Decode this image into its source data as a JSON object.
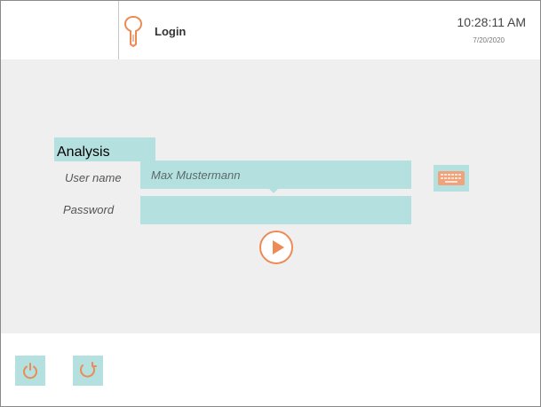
{
  "header": {
    "title": "Login",
    "time": "10:28:11 AM",
    "date": "7/20/2020"
  },
  "overlay_label": "Analysis",
  "login_form": {
    "username_label": "User name",
    "username_value": "Max Mustermann",
    "password_label": "Password",
    "password_value": ""
  },
  "icons": {
    "title": "key-icon",
    "keyboard": "keyboard-icon",
    "login": "play-icon",
    "power": "power-icon",
    "refresh": "refresh-icon"
  },
  "colors": {
    "accent": "#ec8b55",
    "field_background": "#b4e0df",
    "main_background": "#efefef"
  }
}
